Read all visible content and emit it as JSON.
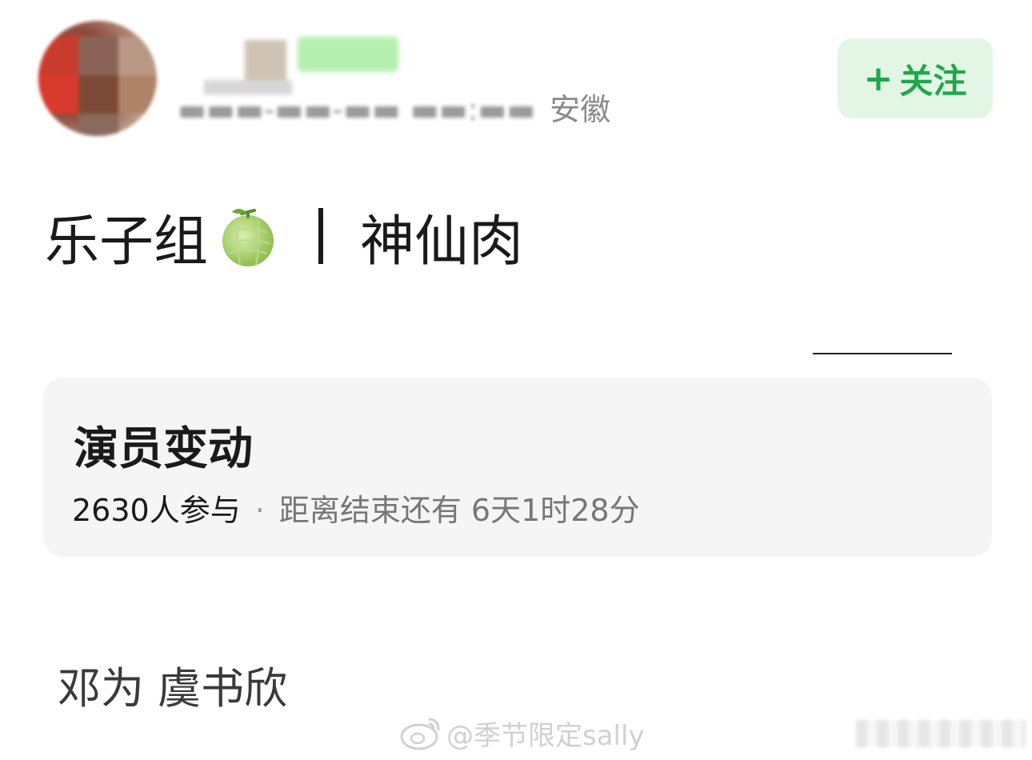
{
  "header": {
    "meta_location": "安徽",
    "follow_label": "关注",
    "follow_plus": "+"
  },
  "post": {
    "title_part1": "乐子组",
    "title_emoji": "melon-emoji",
    "title_part2": "神仙肉"
  },
  "vote": {
    "title": "演员变动",
    "participants": "2630人参与",
    "separator": "·",
    "deadline": "距离结束还有 6天1时28分",
    "option_text": "邓为 虞书欣"
  },
  "watermark": {
    "text": "@季节限定sally",
    "icon": "weibo-icon"
  },
  "colors": {
    "follow_green": "#22a64b",
    "follow_bg": "#e3f6e6",
    "card_bg": "#f5f5f5"
  }
}
